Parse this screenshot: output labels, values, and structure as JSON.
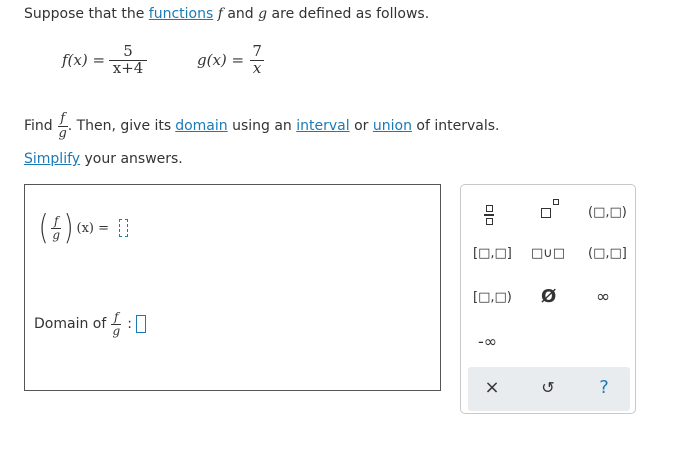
{
  "intro": {
    "prefix": "Suppose that the ",
    "functions_link": "functions",
    "f": "f",
    "and": " and ",
    "g": "g",
    "suffix": " are defined as follows."
  },
  "definitions": {
    "f": {
      "lhs": "f(x) =",
      "numerator": "5",
      "denominator": "x+4"
    },
    "g": {
      "lhs": "g(x) =",
      "numerator": "7",
      "denominator": "x"
    }
  },
  "instruction": {
    "find": "Find",
    "frac_num": "f",
    "frac_den": "g",
    "then_text": ". Then, give its ",
    "domain_link": "domain",
    "using": " using an ",
    "interval_link": "interval",
    "or": " or ",
    "union_link": "union",
    "of_intervals": " of intervals.",
    "simplify_link": "Simplify",
    "your_answers": " your answers."
  },
  "answer": {
    "expr_num": "f",
    "expr_den": "g",
    "expr_arg": "(x) =",
    "domain_label": "Domain of",
    "domain_num": "f",
    "domain_den": "g",
    "domain_colon": ":"
  },
  "palette": {
    "fraction_icon": "fraction-template-icon",
    "superscript_icon": "superscript-template-icon",
    "open_open": "(□,□)",
    "closed_closed": "[□,□]",
    "union": "□∪□",
    "open_closed": "(□,□]",
    "closed_open": "[□,□)",
    "empty_set": "Ø",
    "infinity": "∞",
    "neg_infinity": "-∞",
    "clear": "×",
    "undo": "↺",
    "help": "?"
  },
  "colors": {
    "link": "#1a7ab8",
    "placeholder": "#1a7ab8",
    "footer_bg": "#e8ecef"
  }
}
